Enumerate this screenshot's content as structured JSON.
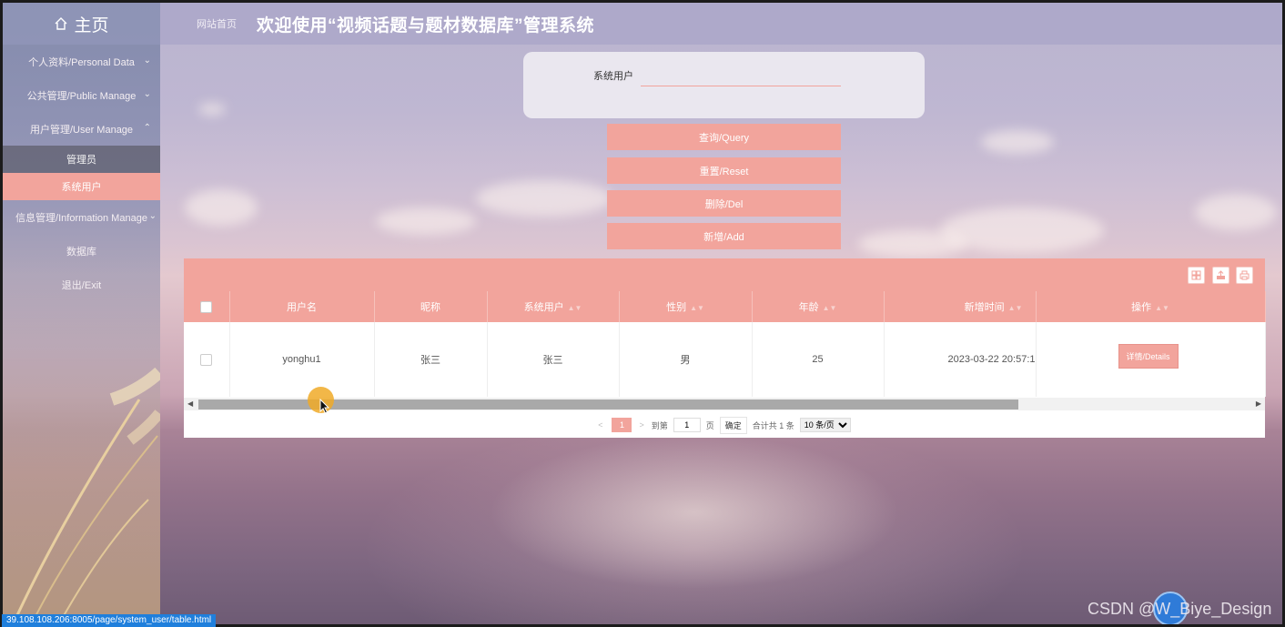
{
  "sidebar": {
    "home_label": "主页",
    "menu": [
      {
        "label": "个人资料/Personal Data",
        "chevron": "⌵"
      },
      {
        "label": "公共管理/Public Manage",
        "chevron": "⌵"
      },
      {
        "label": "用户管理/User Manage",
        "chevron": "^"
      }
    ],
    "sub_items": [
      {
        "label": "管理员"
      },
      {
        "label": "系统用户"
      }
    ],
    "menu_after": [
      {
        "label": "信息管理/Information Manage",
        "chevron": "⌵"
      },
      {
        "label": "数据库"
      },
      {
        "label": "退出/Exit"
      }
    ]
  },
  "header": {
    "breadcrumb": "网站首页",
    "title": "欢迎使用“视频话题与题材数据库”管理系统"
  },
  "search": {
    "label": "系统用户",
    "value": "",
    "placeholder": ""
  },
  "actions": {
    "query": "查询/Query",
    "reset": "重置/Reset",
    "delete": "删除/Del",
    "add": "新增/Add"
  },
  "table": {
    "columns": [
      "用户名",
      "昵称",
      "系统用户",
      "性别",
      "年龄",
      "新增时间",
      "操作"
    ],
    "rows": [
      {
        "username": "yonghu1",
        "nickname": "张三",
        "system_user": "张三",
        "gender": "男",
        "age": "25",
        "created": "2023-03-22 20:57:1",
        "action": "详情/Details"
      }
    ]
  },
  "pager": {
    "prev": "<",
    "current": "1",
    "next": ">",
    "goto_label": "到第",
    "goto_value": "1",
    "page_unit": "页",
    "confirm": "确定",
    "total": "合计共 1 条",
    "page_size": "10 条/页"
  },
  "status_url": "39.108.108.206:8005/page/system_user/table.html",
  "watermark": "CSDN @W_Biye_Design",
  "colors": {
    "accent": "#f2a49c",
    "status_bar": "#1f7fdc"
  }
}
